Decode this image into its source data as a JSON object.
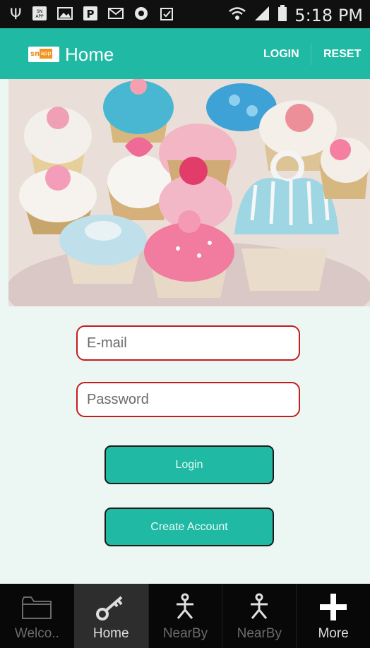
{
  "status_bar": {
    "time": "5:18 PM",
    "left_icons": [
      "usb-icon",
      "snapp-notification-icon",
      "image-icon",
      "parking-icon",
      "gmail-icon",
      "app-notification-icon",
      "clipboard-icon"
    ],
    "right_icons": [
      "wifi-icon",
      "signal-icon",
      "battery-icon"
    ]
  },
  "app_bar": {
    "logo_text": "snappit",
    "title": "Home",
    "actions": {
      "login": "LOGIN",
      "reset": "RESET"
    }
  },
  "hero": {
    "image": "cupcakes-photo"
  },
  "form": {
    "email_placeholder": "E-mail",
    "email_value": "",
    "password_placeholder": "Password",
    "password_value": "",
    "login_button": "Login",
    "create_account_button": "Create Account"
  },
  "tabs": [
    {
      "label": "Welco..",
      "icon": "folder-icon",
      "active": false
    },
    {
      "label": "Home",
      "icon": "key-icon",
      "active": true
    },
    {
      "label": "NearBy",
      "icon": "person-icon",
      "active": false
    },
    {
      "label": "NearBy",
      "icon": "person-icon",
      "active": false
    },
    {
      "label": "More",
      "icon": "plus-icon",
      "active": false
    }
  ],
  "colors": {
    "primary": "#1fb9a4",
    "field_border": "#c51c1c",
    "background": "#ecf7f3"
  }
}
